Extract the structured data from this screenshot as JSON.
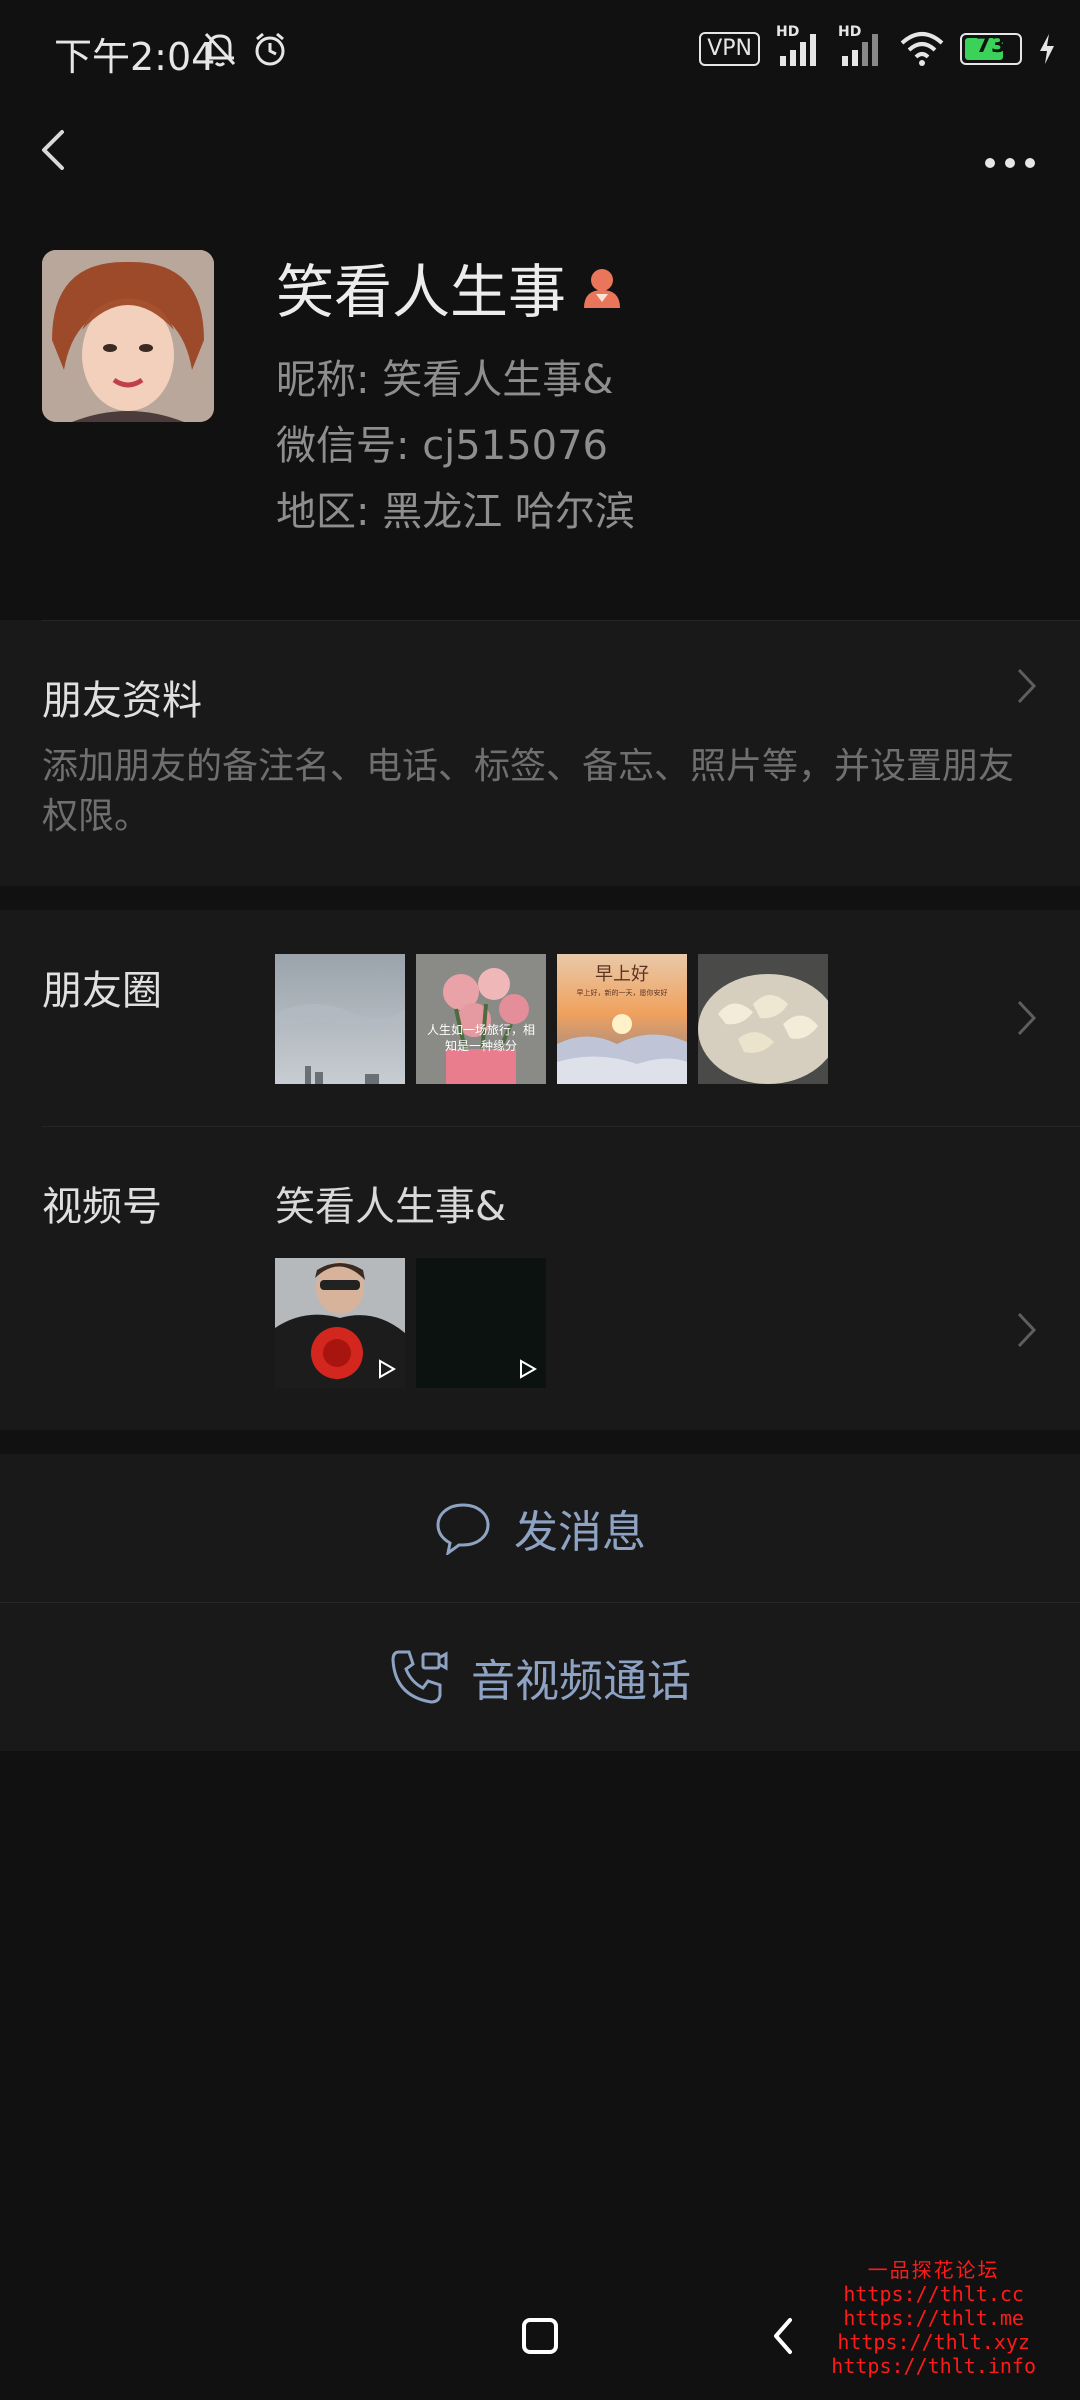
{
  "status_bar": {
    "time": "下午2:04",
    "vpn": "VPN",
    "hd1": "HD",
    "hd2": "HD",
    "battery": "73"
  },
  "profile": {
    "name": "笑看人生事",
    "nickname": "昵称:  笑看人生事&",
    "wechat_id": "微信号:  cj515076",
    "region": "地区:  黑龙江  哈尔滨"
  },
  "friend_info": {
    "title": "朋友资料",
    "desc": "添加朋友的备注名、电话、标签、备忘、照片等，并设置朋友权限。"
  },
  "moments": {
    "title": "朋友圈",
    "thumb2_text": "人生如一场旅行，相知是一种缘分",
    "thumb3_text": "早上好",
    "thumb3_sub": "早上好，新的一天，愿你安好"
  },
  "channels": {
    "title": "视频号",
    "account_name": "笑看人生事&"
  },
  "actions": {
    "message": "发消息",
    "call": "音视频通话"
  },
  "watermark": {
    "title": "一品探花论坛",
    "urls": [
      "https://thlt.cc",
      "https://thlt.me",
      "https://thlt.xyz",
      "https://thlt.info"
    ]
  },
  "colors": {
    "background": "#111111",
    "section": "#191919",
    "action_text": "#8ea3c3",
    "battery": "#3bd25a",
    "watermark": "#ff1a1a"
  }
}
